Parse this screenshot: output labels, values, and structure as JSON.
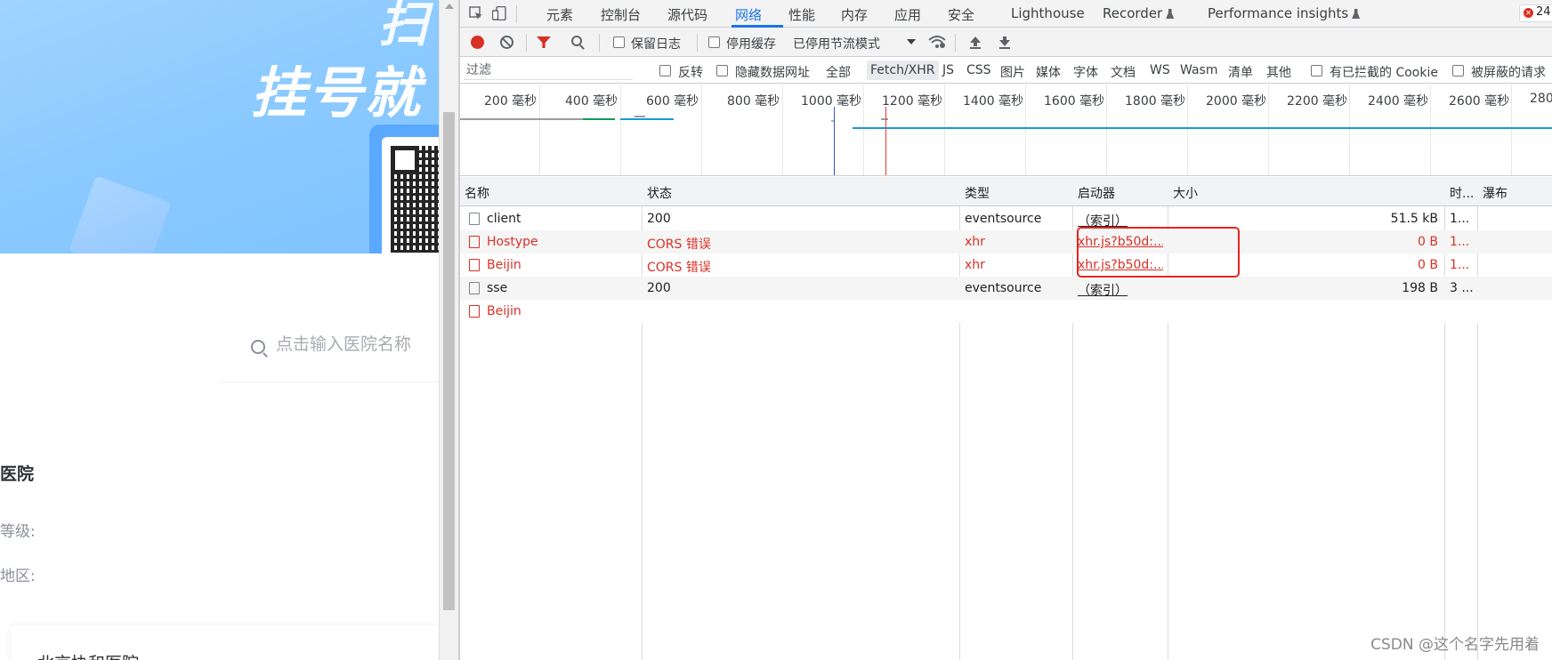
{
  "site": {
    "banner_title_top": "扫",
    "banner_title": "挂号就",
    "search_placeholder": "点击输入医院名称",
    "hospital_heading": "医院",
    "filter_level": "等级:",
    "filter_region": "地区:",
    "card_title": "北京协和医院"
  },
  "devtools": {
    "tabs": [
      "元素",
      "控制台",
      "源代码",
      "网络",
      "性能",
      "内存",
      "应用",
      "安全",
      "Lighthouse",
      "Recorder",
      "Performance insights"
    ],
    "active_tab": "网络",
    "error_count": "24",
    "toolbar": {
      "preserve_log": "保留日志",
      "disable_cache": "停用缓存",
      "throttling": "已停用节流模式"
    },
    "filter": {
      "placeholder": "过滤",
      "invert": "反转",
      "hide_data_urls": "隐藏数据网址",
      "types": [
        "全部",
        "Fetch/XHR",
        "JS",
        "CSS",
        "图片",
        "媒体",
        "字体",
        "文档",
        "WS",
        "Wasm",
        "清单",
        "其他"
      ],
      "selected_type": "Fetch/XHR",
      "blocked_cookies": "有已拦截的 Cookie",
      "blocked_requests": "被屏蔽的请求"
    },
    "overview": {
      "ticks": [
        "200 毫秒",
        "400 毫秒",
        "600 毫秒",
        "800 毫秒",
        "1000 毫秒",
        "1200 毫秒",
        "1400 毫秒",
        "1600 毫秒",
        "1800 毫秒",
        "2000 毫秒",
        "2200 毫秒",
        "2400 毫秒",
        "2600 毫秒",
        "280"
      ]
    },
    "columns": {
      "name": "名称",
      "status": "状态",
      "type": "类型",
      "initiator": "启动器",
      "size": "大小",
      "time": "时...",
      "waterfall": "瀑布"
    },
    "requests": [
      {
        "name": "client",
        "status": "200",
        "type": "eventsource",
        "initiator": "（索引）",
        "size": "51.5 kB",
        "time": "1...",
        "error": false
      },
      {
        "name": "Hostype",
        "status": "CORS 错误",
        "type": "xhr",
        "initiator": "xhr.js?b50d:...",
        "size": "0 B",
        "time": "1...",
        "error": true
      },
      {
        "name": "Beijin",
        "status": "CORS 错误",
        "type": "xhr",
        "initiator": "xhr.js?b50d:...",
        "size": "0 B",
        "time": "1...",
        "error": true
      },
      {
        "name": "sse",
        "status": "200",
        "type": "eventsource",
        "initiator": "（索引）",
        "size": "198 B",
        "time": "3 ...",
        "error": false
      },
      {
        "name": "Beijin",
        "status": "",
        "type": "",
        "initiator": "",
        "size": "",
        "time": "",
        "error": true
      }
    ]
  },
  "watermark": "CSDN @这个名字先用着",
  "colors": {
    "accent": "#1a73e8",
    "error": "#d93025",
    "highlight_box": "#e52420"
  }
}
